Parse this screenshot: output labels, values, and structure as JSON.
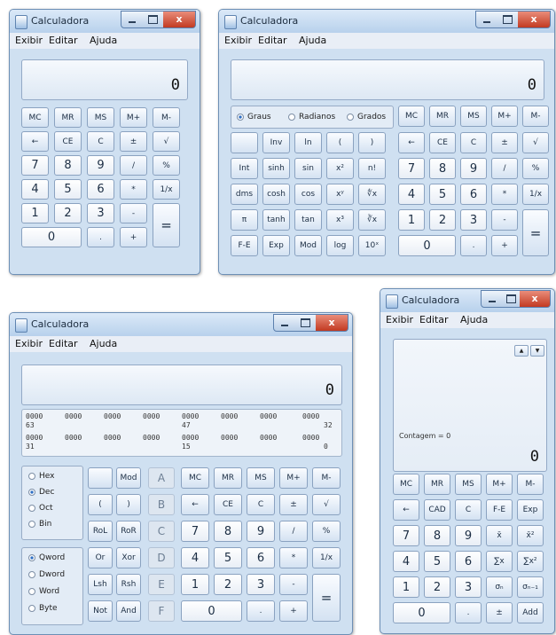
{
  "common": {
    "title": "Calculadora",
    "close_glyph": "x",
    "menu": [
      "Exibir",
      "Editar",
      "Ajuda"
    ],
    "display_value": "0"
  },
  "standard": {
    "rows": [
      [
        "MC",
        "MR",
        "MS",
        "M+",
        "M-"
      ],
      [
        "←",
        "CE",
        "C",
        "±",
        "√"
      ],
      [
        "7",
        "8",
        "9",
        "/",
        "%"
      ],
      [
        "4",
        "5",
        "6",
        "*",
        "1/x"
      ],
      [
        "1",
        "2",
        "3",
        "-",
        "="
      ],
      [
        "0",
        ".",
        "+"
      ]
    ]
  },
  "scientific": {
    "angle_modes": [
      "Graus",
      "Radianos",
      "Grados"
    ],
    "selected_angle": "Graus",
    "memory": [
      "MC",
      "MR",
      "MS",
      "M+",
      "M-"
    ],
    "sci_rows": [
      [
        "",
        "Inv",
        "ln",
        "(",
        ")"
      ],
      [
        "Int",
        "sinh",
        "sin",
        "x²",
        "n!"
      ],
      [
        "dms",
        "cosh",
        "cos",
        "xʸ",
        "∜x"
      ],
      [
        "π",
        "tanh",
        "tan",
        "x³",
        "∛x"
      ],
      [
        "F-E",
        "Exp",
        "Mod",
        "log",
        "10ˣ"
      ]
    ],
    "num_rows": [
      [
        "←",
        "CE",
        "C",
        "±",
        "√"
      ],
      [
        "7",
        "8",
        "9",
        "/",
        "%"
      ],
      [
        "4",
        "5",
        "6",
        "*",
        "1/x"
      ],
      [
        "1",
        "2",
        "3",
        "-",
        "="
      ],
      [
        "0",
        ".",
        "+"
      ]
    ]
  },
  "programmer": {
    "bits_row1": [
      "0000",
      "0000",
      "0000",
      "0000",
      "0000",
      "0000",
      "0000",
      "0000"
    ],
    "bits_row1_labels": [
      "63",
      "47",
      "32"
    ],
    "bits_row2": [
      "0000",
      "0000",
      "0000",
      "0000",
      "0000",
      "0000",
      "0000",
      "0000"
    ],
    "bits_row2_labels": [
      "31",
      "15",
      "0"
    ],
    "bases": [
      "Hex",
      "Dec",
      "Oct",
      "Bin"
    ],
    "selected_base": "Dec",
    "word_sizes": [
      "Qword",
      "Dword",
      "Word",
      "Byte"
    ],
    "selected_word": "Qword",
    "logic_rows": [
      [
        "",
        "Mod"
      ],
      [
        "(",
        ")"
      ],
      [
        "RoL",
        "RoR"
      ],
      [
        "Or",
        "Xor"
      ],
      [
        "Lsh",
        "Rsh"
      ],
      [
        "Not",
        "And"
      ]
    ],
    "hex_letters": [
      "A",
      "B",
      "C",
      "D",
      "E",
      "F"
    ],
    "num_rows": [
      [
        "MC",
        "MR",
        "MS",
        "M+",
        "M-"
      ],
      [
        "←",
        "CE",
        "C",
        "±",
        "√"
      ],
      [
        "7",
        "8",
        "9",
        "/",
        "%"
      ],
      [
        "4",
        "5",
        "6",
        "*",
        "1/x"
      ],
      [
        "1",
        "2",
        "3",
        "-",
        "="
      ],
      [
        "0",
        ".",
        "+"
      ]
    ]
  },
  "statistics": {
    "count_label": "Contagem = 0",
    "arrow_up": "▲",
    "arrow_down": "▼",
    "rows": [
      [
        "MC",
        "MR",
        "MS",
        "M+",
        "M-"
      ],
      [
        "←",
        "CAD",
        "C",
        "F-E",
        "Exp"
      ],
      [
        "7",
        "8",
        "9",
        "x̄",
        "x̄²"
      ],
      [
        "4",
        "5",
        "6",
        "∑x",
        "∑x²"
      ],
      [
        "1",
        "2",
        "3",
        "σₙ",
        "σₙ₋₁"
      ],
      [
        "0",
        ".",
        "±",
        "Add"
      ]
    ]
  }
}
